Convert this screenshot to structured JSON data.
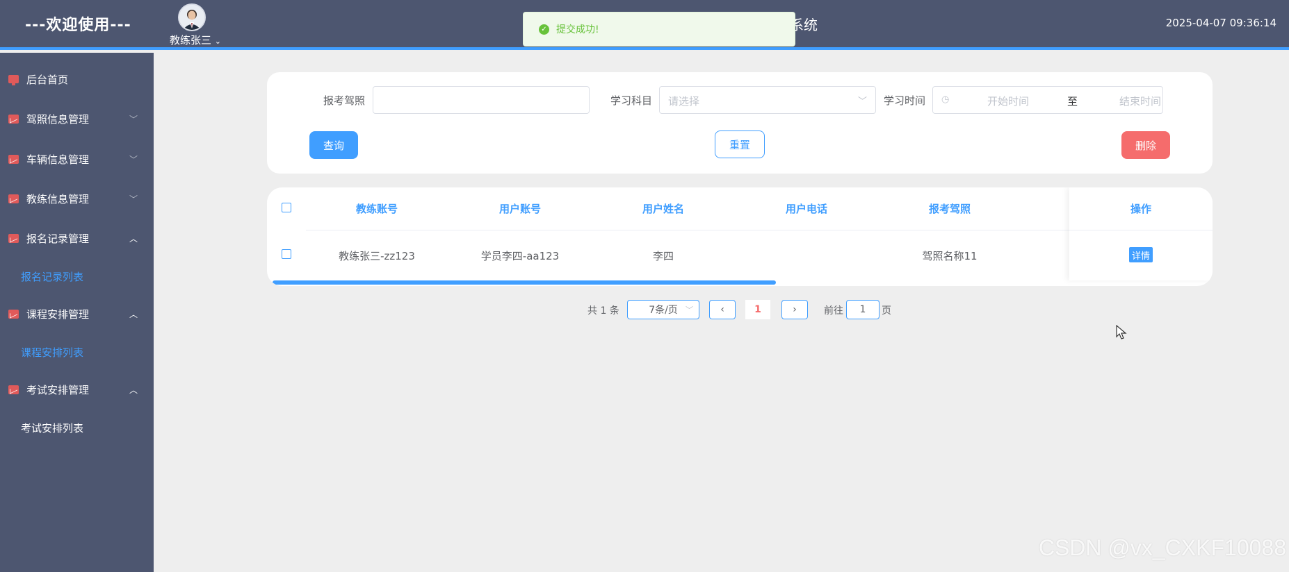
{
  "header": {
    "welcome": "---欢迎使用---",
    "user_name": "教练张三",
    "system_title": "系统",
    "datetime": "2025-04-07 09:36:14"
  },
  "toast": {
    "message": "提交成功!"
  },
  "sidebar": {
    "items": [
      {
        "label": "后台首页",
        "icon": "monitor-icon"
      },
      {
        "label": "驾照信息管理",
        "icon": "chart-icon"
      },
      {
        "label": "车辆信息管理",
        "icon": "chart-icon"
      },
      {
        "label": "教练信息管理",
        "icon": "chart-icon"
      },
      {
        "label": "报名记录管理",
        "icon": "chart-icon"
      },
      {
        "label": "课程安排管理",
        "icon": "chart-icon"
      },
      {
        "label": "考试安排管理",
        "icon": "chart-icon"
      }
    ],
    "sub_items": {
      "registration_list": "报名记录列表",
      "course_list": "课程安排列表",
      "exam_list": "考试安排列表"
    }
  },
  "search": {
    "license_label": "报考驾照",
    "license_value": "",
    "subject_label": "学习科目",
    "subject_placeholder": "请选择",
    "time_label": "学习时间",
    "start_placeholder": "开始时间",
    "range_separator": "至",
    "end_placeholder": "结束时间",
    "query_button": "查询",
    "reset_button": "重置",
    "delete_button": "删除"
  },
  "table": {
    "columns": [
      "教练账号",
      "用户账号",
      "用户姓名",
      "用户电话",
      "报考驾照",
      "操作"
    ],
    "rows": [
      {
        "coach_account": "教练张三-zz123",
        "user_account": "学员李四-aa123",
        "user_name": "李四",
        "user_phone": "",
        "license": "驾照名称11",
        "action": "详情"
      }
    ]
  },
  "pagination": {
    "total_text": "共 1 条",
    "page_size": "7条/页",
    "current_page": "1",
    "goto_label": "前往",
    "goto_value": "1",
    "page_unit": "页"
  },
  "watermark": "CSDN @vx_CXKF10088",
  "colors": {
    "primary": "#409eff",
    "danger": "#f56c6c",
    "success": "#67c23a",
    "header_bg": "#4d5670"
  }
}
